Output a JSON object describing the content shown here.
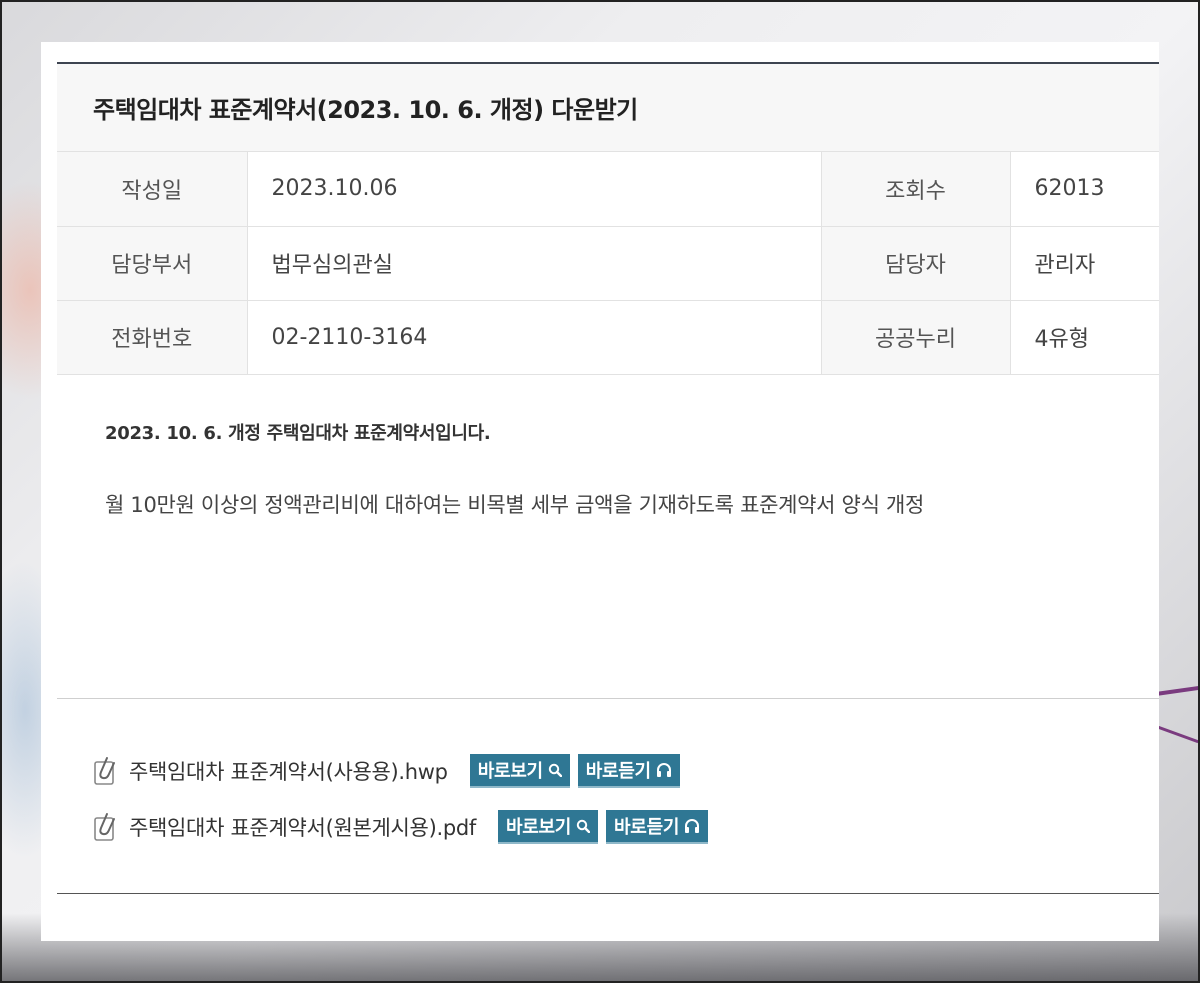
{
  "post": {
    "title": "주택임대차 표준계약서(2023. 10. 6. 개정) 다운받기"
  },
  "info": {
    "row1": {
      "label_a": "작성일",
      "value_a": "2023.10.06",
      "label_b": "조회수",
      "value_b": "62013"
    },
    "row2": {
      "label_a": "담당부서",
      "value_a": "법무심의관실",
      "label_b": "담당자",
      "value_b": "관리자"
    },
    "row3": {
      "label_a": "전화번호",
      "value_a": "02-2110-3164",
      "label_b": "공공누리",
      "value_b": "4유형"
    }
  },
  "content": {
    "lead": "2023. 10. 6. 개정 주택임대차 표준계약서입니다.",
    "body": "월 10만원 이상의 정액관리비에 대하여는 비목별 세부 금액을 기재하도록 표준계약서 양식 개정"
  },
  "attachments": [
    {
      "name": "주택임대차 표준계약서(사용용).hwp",
      "view_label": "바로보기",
      "listen_label": "바로듣기"
    },
    {
      "name": "주택임대차 표준계약서(원본게시용).pdf",
      "view_label": "바로보기",
      "listen_label": "바로듣기"
    }
  ],
  "icons": {
    "attachment": "paperclip-icon",
    "view": "magnifier-icon",
    "listen": "headphones-icon"
  },
  "colors": {
    "button_bg": "#2f7794",
    "title_border": "#3d4450"
  }
}
